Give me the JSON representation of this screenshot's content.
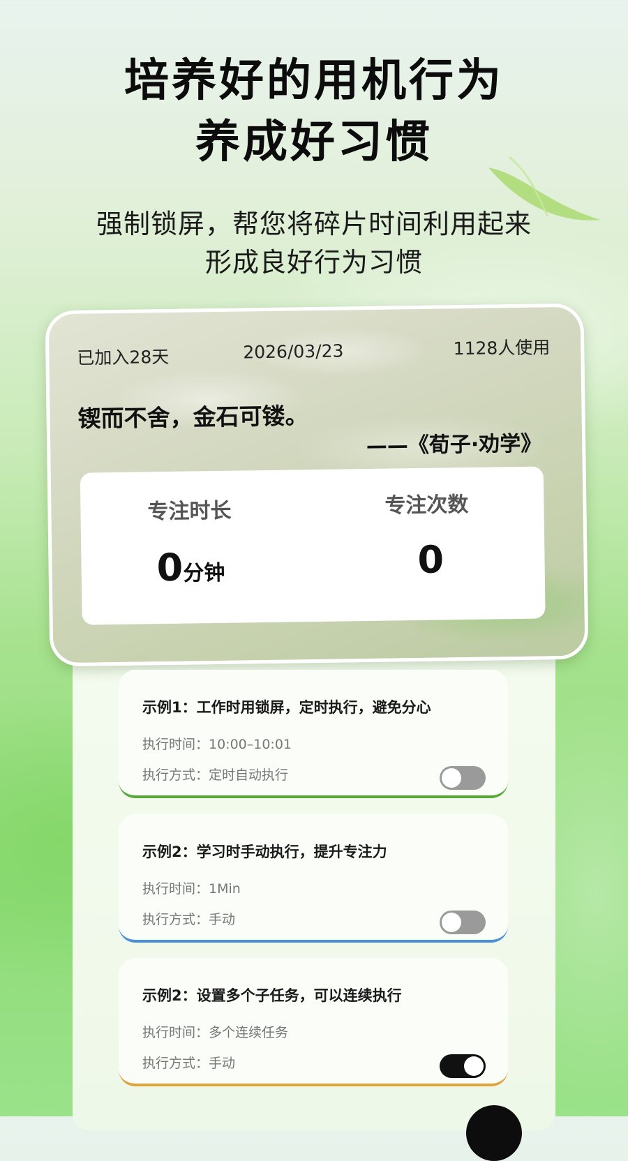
{
  "headline": {
    "line1": "培养好的用机行为",
    "line2": "养成好习惯"
  },
  "subtitle": {
    "line1": "强制锁屏，帮您将碎片时间利用起来",
    "line2": "形成良好行为习惯"
  },
  "quote_card": {
    "days_joined": "已加入28天",
    "date": "2026/03/23",
    "users": "1128人使用",
    "quote": "锲而不舍，金石可镂。",
    "source": "——《荀子·劝学》"
  },
  "stats": {
    "duration_label": "专注时长",
    "duration_value": "0",
    "duration_unit": "分钟",
    "count_label": "专注次数",
    "count_value": "0"
  },
  "examples": [
    {
      "title": "示例1：工作时用锁屏，定时执行，避免分心",
      "time": "执行时间：10:00–10:01",
      "mode": "执行方式：定时自动执行",
      "enabled": false,
      "accent": "#5aa83a"
    },
    {
      "title": "示例2：学习时手动执行，提升专注力",
      "time": "执行时间：1Min",
      "mode": "执行方式：手动",
      "enabled": false,
      "accent": "#4a90d9"
    },
    {
      "title": "示例2：设置多个子任务，可以连续执行",
      "time": "执行时间：多个连续任务",
      "mode": "执行方式：手动",
      "enabled": true,
      "accent": "#e0a23a"
    }
  ],
  "colors": {
    "background_green": "#8fdc78",
    "toggle_off": "#9a9a9a",
    "toggle_on": "#111111"
  }
}
